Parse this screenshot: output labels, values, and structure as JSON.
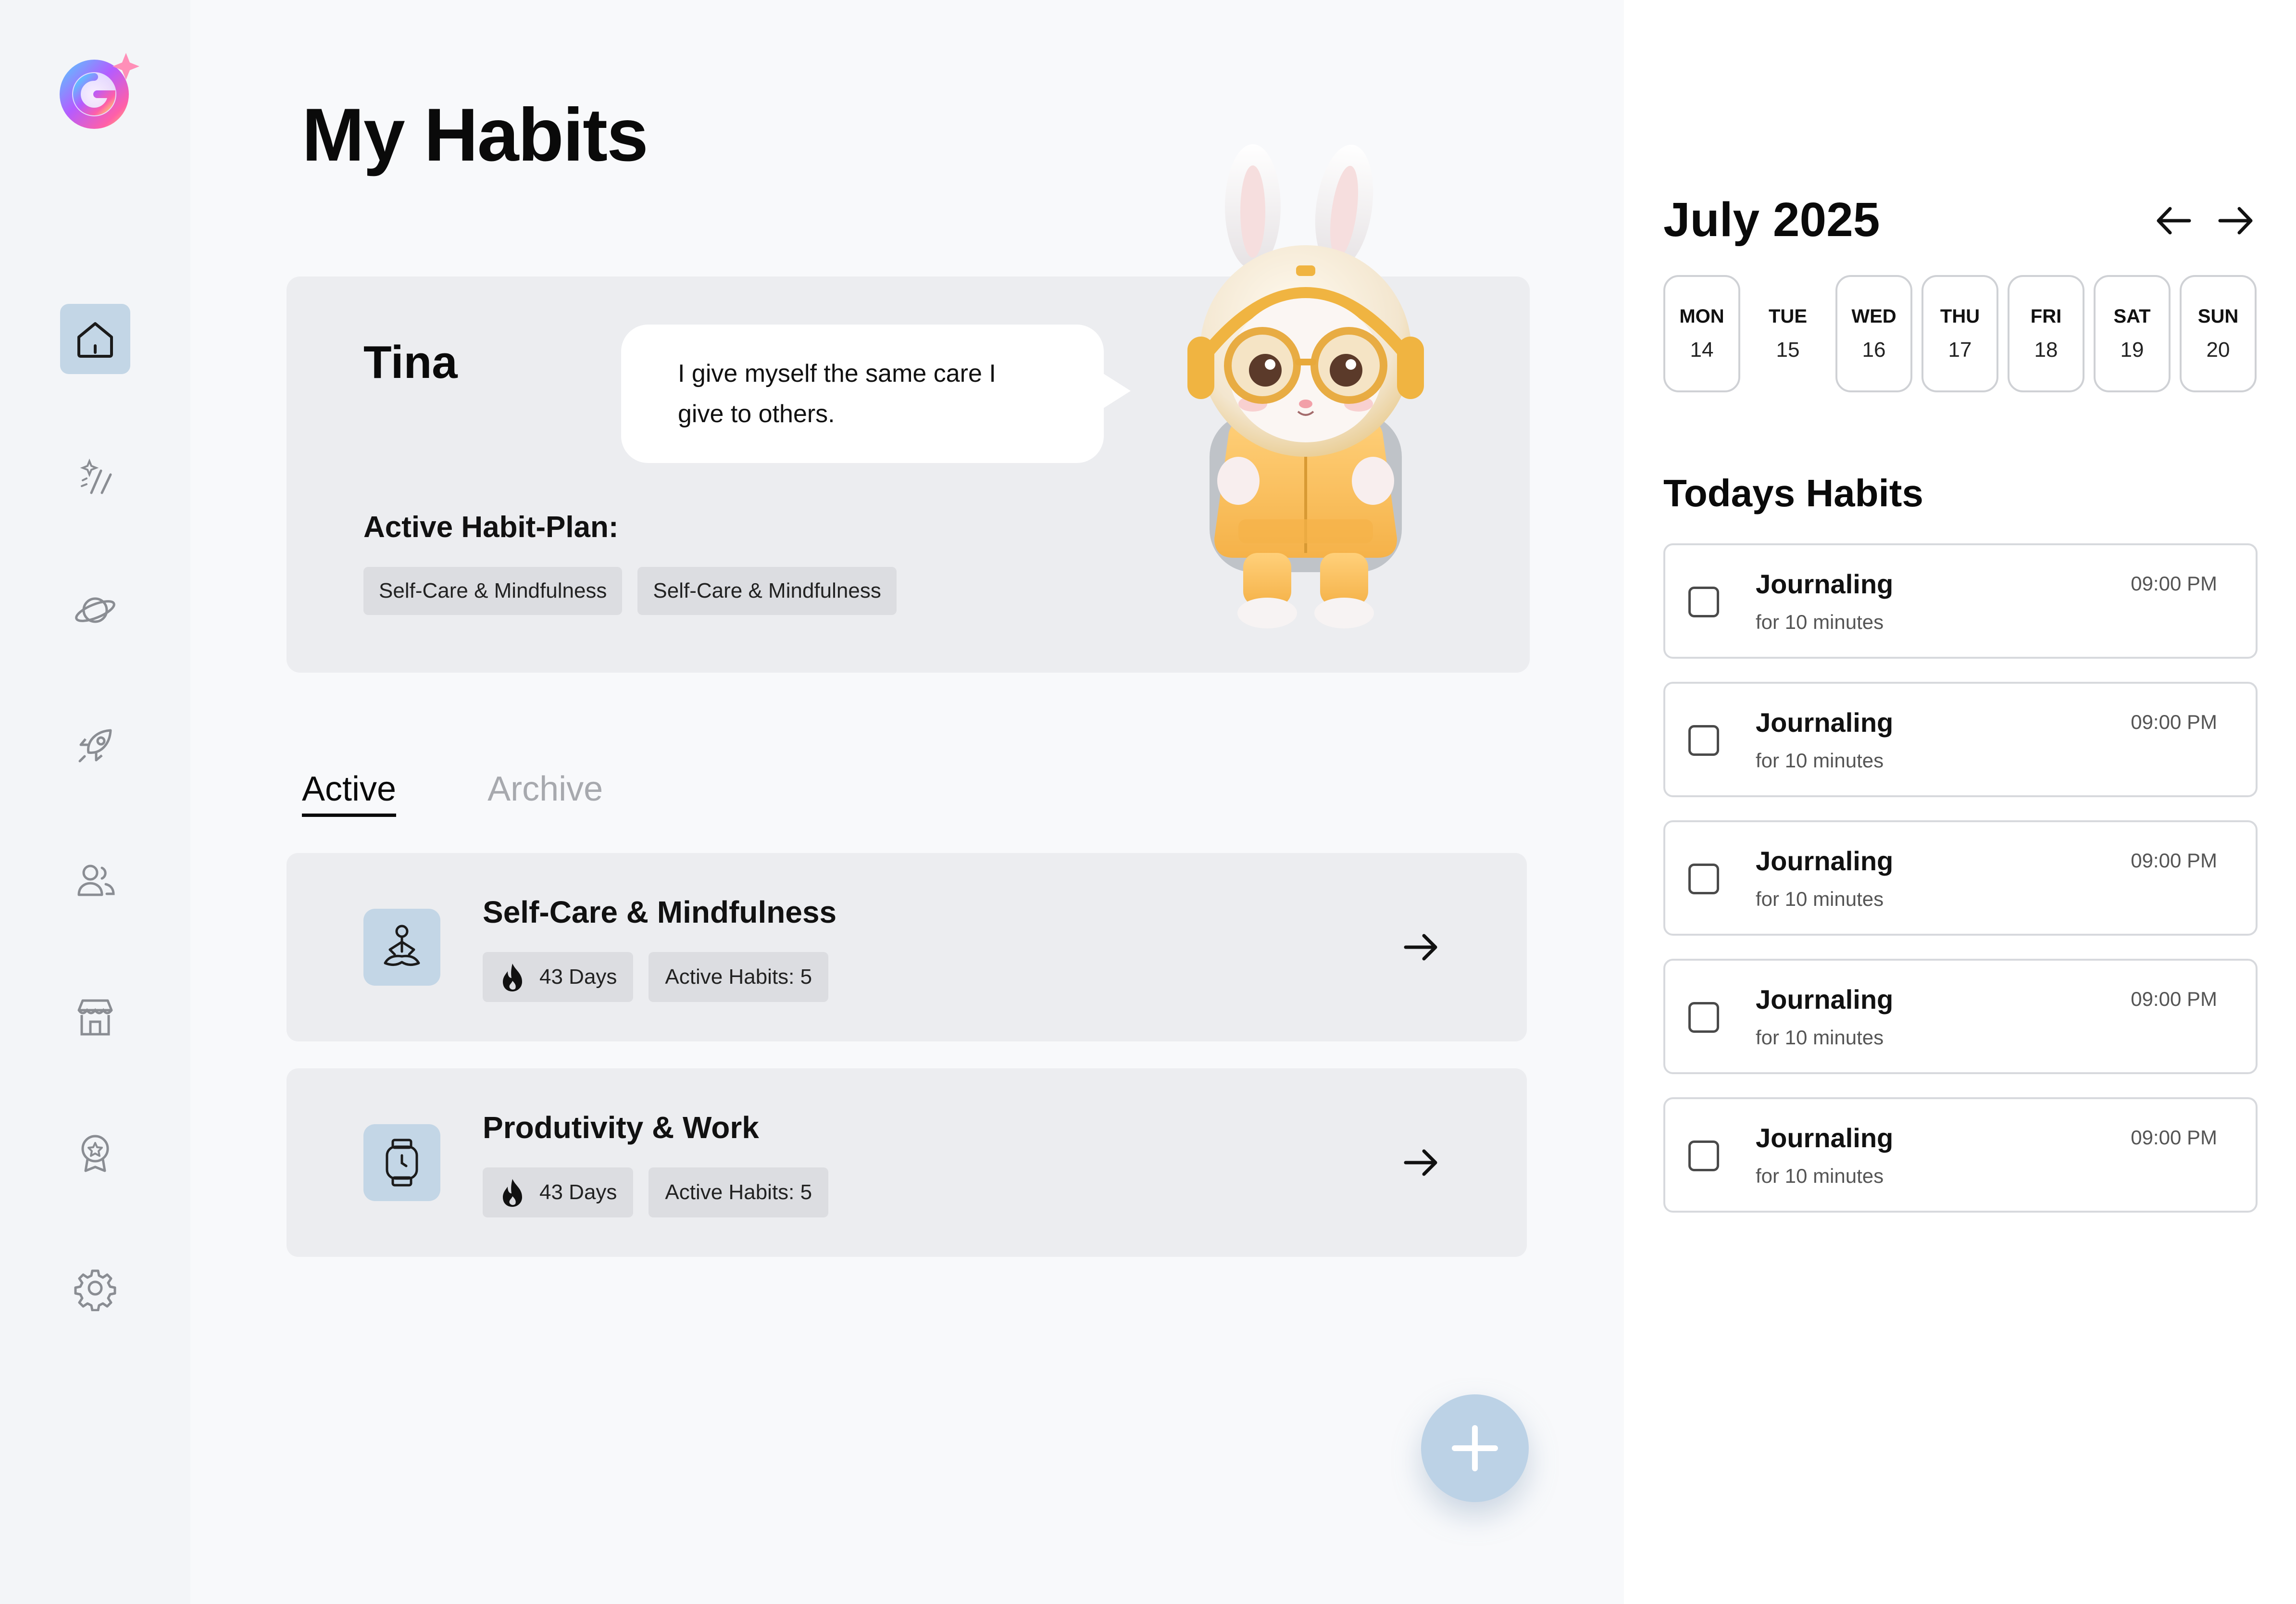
{
  "colors": {
    "accent": "#c3d6e6",
    "fab": "#bcd2e6",
    "card": "#ecedf0",
    "chip": "#dcdde1"
  },
  "sidebar": {
    "items": [
      {
        "icon": "home-icon",
        "active": true
      },
      {
        "icon": "sparkle-wand-icon",
        "active": false
      },
      {
        "icon": "planet-icon",
        "active": false
      },
      {
        "icon": "rocket-icon",
        "active": false
      },
      {
        "icon": "users-icon",
        "active": false
      },
      {
        "icon": "store-icon",
        "active": false
      },
      {
        "icon": "badge-icon",
        "active": false
      },
      {
        "icon": "gear-icon",
        "active": false
      }
    ]
  },
  "main": {
    "title": "My Habits",
    "profile": {
      "name": "Tina",
      "quote": "I give myself the same care I give to others.",
      "plan_label": "Active Habit-Plan:",
      "plan_tags": [
        "Self-Care & Mindfulness",
        "Self-Care & Mindfulness"
      ]
    },
    "tabs": [
      {
        "label": "Active",
        "active": true
      },
      {
        "label": "Archive",
        "active": false
      }
    ],
    "plans": [
      {
        "name": "Self-Care & Mindfulness",
        "streak": "43 Days",
        "habits": "Active Habits: 5",
        "icon": "meditation-icon"
      },
      {
        "name": "Produtivity & Work",
        "streak": "43 Days",
        "habits": "Active Habits: 5",
        "icon": "smartwatch-icon"
      }
    ]
  },
  "calendar": {
    "month": "July 2025",
    "days": [
      {
        "name": "MON",
        "date": "14",
        "outlined": true
      },
      {
        "name": "TUE",
        "date": "15",
        "outlined": false
      },
      {
        "name": "WED",
        "date": "16",
        "outlined": true
      },
      {
        "name": "THU",
        "date": "17",
        "outlined": true
      },
      {
        "name": "FRI",
        "date": "18",
        "outlined": true
      },
      {
        "name": "SAT",
        "date": "19",
        "outlined": true
      },
      {
        "name": "SUN",
        "date": "20",
        "outlined": true
      }
    ]
  },
  "today": {
    "title": "Todays Habits",
    "habits": [
      {
        "name": "Journaling",
        "duration": "for 10 minutes",
        "time": "09:00 PM"
      },
      {
        "name": "Journaling",
        "duration": "for 10 minutes",
        "time": "09:00 PM"
      },
      {
        "name": "Journaling",
        "duration": "for 10 minutes",
        "time": "09:00 PM"
      },
      {
        "name": "Journaling",
        "duration": "for 10 minutes",
        "time": "09:00 PM"
      },
      {
        "name": "Journaling",
        "duration": "for 10 minutes",
        "time": "09:00 PM"
      }
    ]
  }
}
